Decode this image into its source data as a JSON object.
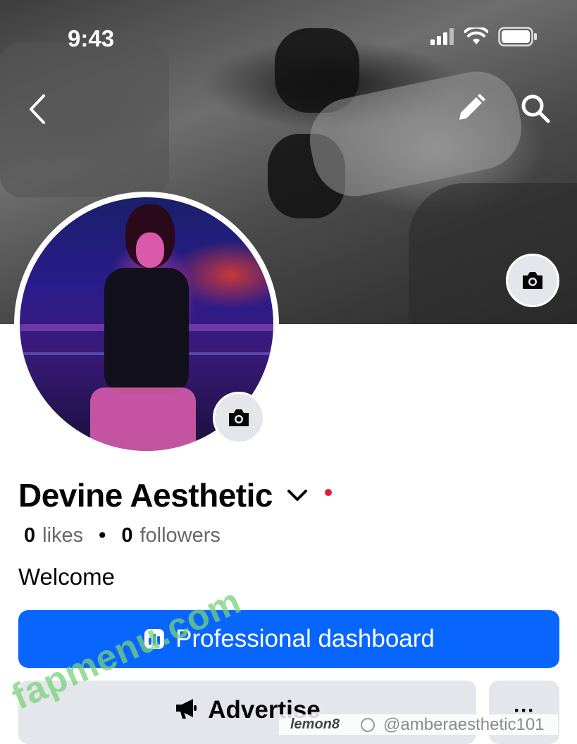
{
  "status_bar": {
    "time": "9:43"
  },
  "header": {
    "back_icon": "chevron-left-icon",
    "edit_icon": "pencil-icon",
    "search_icon": "search-icon"
  },
  "profile": {
    "name": "Devine Aesthetic",
    "likes_count": "0",
    "likes_label": "likes",
    "separator": "•",
    "followers_count": "0",
    "followers_label": "followers",
    "bio": "Welcome"
  },
  "actions": {
    "dashboard_label": "Professional dashboard",
    "advertise_label": "Advertise",
    "more_label": "···"
  },
  "overlays": {
    "watermark": "fapmenu.com",
    "bottom_brand": "lemon8",
    "bottom_handle": "@amberaesthetic101"
  },
  "colors": {
    "primary": "#0866ff",
    "secondary_btn": "#e4e6eb",
    "notification_dot": "#e41e3f"
  }
}
